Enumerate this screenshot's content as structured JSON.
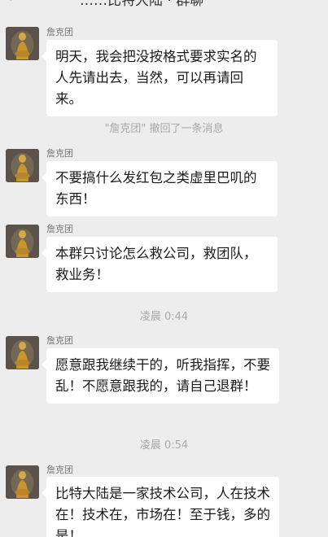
{
  "header": {
    "back_icon": "chevron-left-icon",
    "title": "……比特大陆 · 群聊",
    "menu_icon": "more-icon"
  },
  "messages": [
    {
      "sender": "詹克团",
      "text": "明天，我会把没按格式要求实名的人先请出去，当然，可以再请回来。"
    },
    {
      "system": "\"詹克团\" 撤回了一条消息"
    },
    {
      "sender": "詹克团",
      "text": "不要搞什么发红包之类虚里巴叽的东西！"
    },
    {
      "sender": "詹克团",
      "text": "本群只讨论怎么救公司，救团队，救业务！"
    },
    {
      "time": "凌晨 0:44"
    },
    {
      "sender": "詹克团",
      "text": "愿意跟我继续干的，听我指挥，不要乱！不愿意跟我的，请自己退群！"
    },
    {
      "time": "凌晨 0:54"
    },
    {
      "sender": "詹克团",
      "text": "比特大陆是一家技术公司，人在技术在！技术在，市场在！至于钱，多的是！"
    }
  ],
  "colors": {
    "background": "#ededed",
    "bubble": "#ffffff",
    "system_text": "#a9a9a9",
    "sender_text": "#777777"
  }
}
